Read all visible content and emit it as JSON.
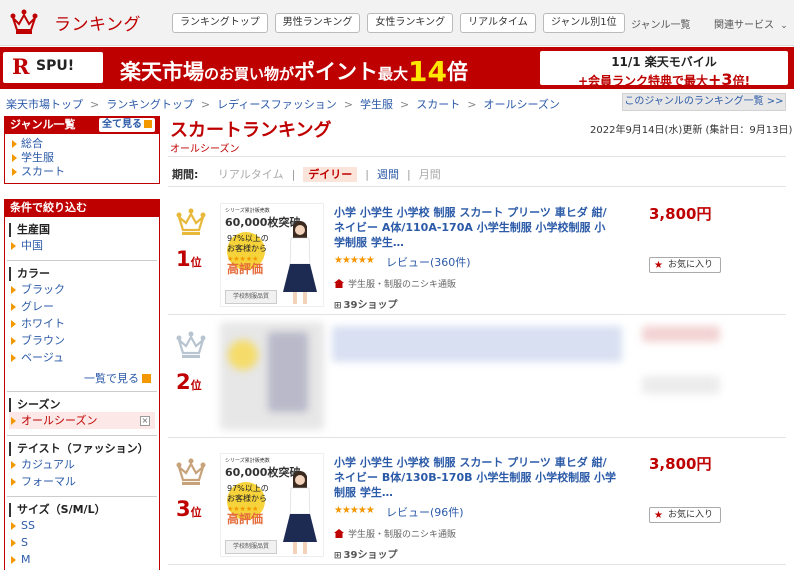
{
  "header": {
    "logo_icon": "crown-icon",
    "title": "ランキング",
    "nav": [
      "ランキングトップ",
      "男性ランキング",
      "女性ランキング",
      "リアルタイム",
      "ジャンル別1位"
    ],
    "genre_list": "ジャンル一覧",
    "related": "関連サービス"
  },
  "banner": {
    "spu_r": "R",
    "spu_text": "SPU!",
    "main_a": "楽天市場",
    "main_b": "のお買い物",
    "main_c": "が",
    "main_d": "ポイント",
    "main_e": "最大",
    "main_num": "14",
    "main_f": "倍",
    "box_line1": "11/1 楽天モバイル",
    "box_line2a": "+会員ランク特典で最大",
    "box_line2b": "+3",
    "box_line2c": "倍!"
  },
  "breadcrumb": [
    "楽天市場トップ",
    "ランキングトップ",
    "レディースファッション",
    "学生服",
    "スカート",
    "オールシーズン"
  ],
  "breadcrumb_sep": ">",
  "genre_ranking_link": "このジャンルのランキング一覧 >>",
  "sidebar": {
    "genre_header": "ジャンル一覧",
    "show_all": "全て見る",
    "genres": [
      "総合",
      "学生服",
      "スカート"
    ],
    "filter_header": "条件で絞り込む",
    "origin_title": "生産国",
    "origins": [
      "中国"
    ],
    "color_title": "カラー",
    "colors": [
      "ブラック",
      "グレー",
      "ホワイト",
      "ブラウン",
      "ベージュ"
    ],
    "see_list": "一覧で見る",
    "season_title": "シーズン",
    "season_selected": "オールシーズン",
    "taste_title": "テイスト（ファッション）",
    "tastes": [
      "カジュアル",
      "フォーマル"
    ],
    "size_title": "サイズ（S/M/L）",
    "sizes": [
      "SS",
      "S",
      "M"
    ]
  },
  "main": {
    "title": "スカートランキング",
    "subtitle": "オールシーズン",
    "updated": "2022年9月14日(水)更新 (集計日：9月13日)",
    "period_label": "期間:",
    "periods": [
      "リアルタイム",
      "デイリー",
      "週間",
      "月間"
    ]
  },
  "items": [
    {
      "rank": "1",
      "rank_suffix": "位",
      "crown_color": "#e8b83a",
      "name": "小学 小学生 小学校 制服 スカート プリーツ 車ヒダ 紺/ネイビー A体/110A-170A 小学生制服 小学校制服 小学制服 学生…",
      "rating": 4.5,
      "stars": "★★★★★",
      "reviews": "レビュー(360件)",
      "shop": "学生服・制服のニシキ通販",
      "shops": "39ショップ",
      "price": "3,800円",
      "fav": "お気に入り",
      "thumb_top_small": "シリーズ累計販売数",
      "thumb_top_big": "60,000枚突破",
      "thumb_pct": "97%以上の",
      "thumb_line2": "お客様から",
      "thumb_stars": "★★★★★",
      "thumb_high": "高評価",
      "thumb_badge": "学校制服品質"
    },
    {
      "rank": "2",
      "rank_suffix": "位",
      "crown_color": "#b8c4cf"
    },
    {
      "rank": "3",
      "rank_suffix": "位",
      "crown_color": "#c7a27a",
      "name": "小学 小学生 小学校 制服 スカート プリーツ 車ヒダ 紺/ネイビー B体/130B-170B 小学生制服 小学校制服 小学制服 学生…",
      "rating": 4.5,
      "stars": "★★★★★",
      "reviews": "レビュー(96件)",
      "shop": "学生服・制服のニシキ通販",
      "shops": "39ショップ",
      "price": "3,800円",
      "fav": "お気に入り",
      "thumb_top_small": "シリーズ累計販売数",
      "thumb_top_big": "60,000枚突破",
      "thumb_pct": "97%以上の",
      "thumb_line2": "お客様から",
      "thumb_stars": "★★★★★",
      "thumb_high": "高評価",
      "thumb_badge": "学校制服品質"
    }
  ]
}
